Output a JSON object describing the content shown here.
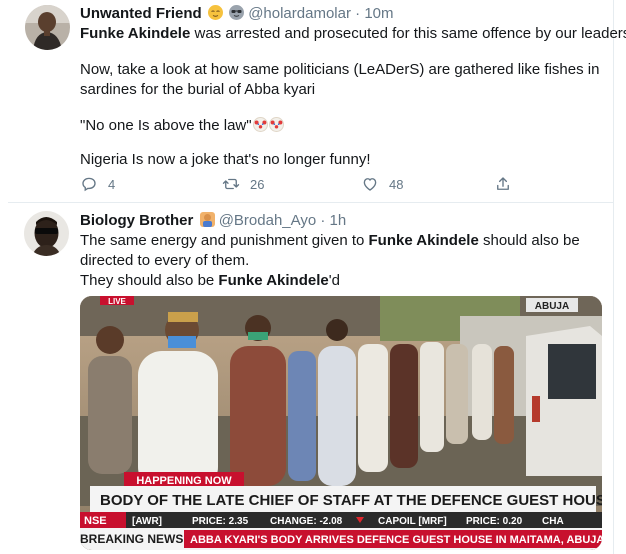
{
  "tweets": [
    {
      "author": "Unwanted Friend",
      "name_emoji_1": "relieved-face",
      "name_emoji_2": "sunglasses-face",
      "handle": "@holardamolar",
      "separator": "·",
      "time": "10m",
      "lines": [
        {
          "bold": "Funke Akindele",
          "rest": " was arrested and prosecuted for this same offence by our leaders!"
        },
        {
          "text": "Now, take a look at how same politicians (LeADerS)  are gathered like fishes in"
        },
        {
          "text": "sardines for the burial of Abba kyari"
        },
        {
          "text": "\"No one Is above the law\""
        },
        {
          "text": "Nigeria Is now a joke that's no longer funny!"
        }
      ],
      "clown_emoji": "clown-face",
      "reply_count": "4",
      "retweet_count": "26",
      "like_count": "48"
    },
    {
      "author": "Biology Brother",
      "name_emoji": "man-facepalming",
      "handle": "@Brodah_Ayo",
      "separator": "·",
      "time": "1h",
      "line1_pre": "The same energy and punishment given to ",
      "line1_bold": "Funke Akindele",
      "line1_post": " should also be",
      "line2": "directed to every of them.",
      "line3_pre": "They should also be ",
      "line3_bold": "Funke Akindele",
      "line3_post": "'d",
      "media": {
        "tag": "ABUJA",
        "live_tag": "LIVE",
        "banner_small": "HAPPENING NOW",
        "banner_main": "BODY OF THE LATE CHIEF OF STAFF AT THE DEFENCE GUEST HOUSE",
        "ticker_1": "NSE",
        "ticker_2": "[AWR]",
        "ticker_3": "PRICE: 2.35",
        "ticker_4": "CHANGE: -2.08",
        "ticker_5": "CAPOIL [MRF]",
        "ticker_6": "PRICE: 0.20",
        "ticker_7": "CHA",
        "breaking_label": "BREAKING NEWS",
        "breaking_text": "ABBA KYARI'S BODY ARRIVES DEFENCE GUEST HOUSE IN MAITAMA, ABUJA"
      }
    }
  ],
  "colors": {
    "text": "#14171a",
    "muted": "#657786",
    "divider": "#e6ecf0",
    "banner_red": "#c8102e",
    "banner_white": "#f4f4f4"
  }
}
